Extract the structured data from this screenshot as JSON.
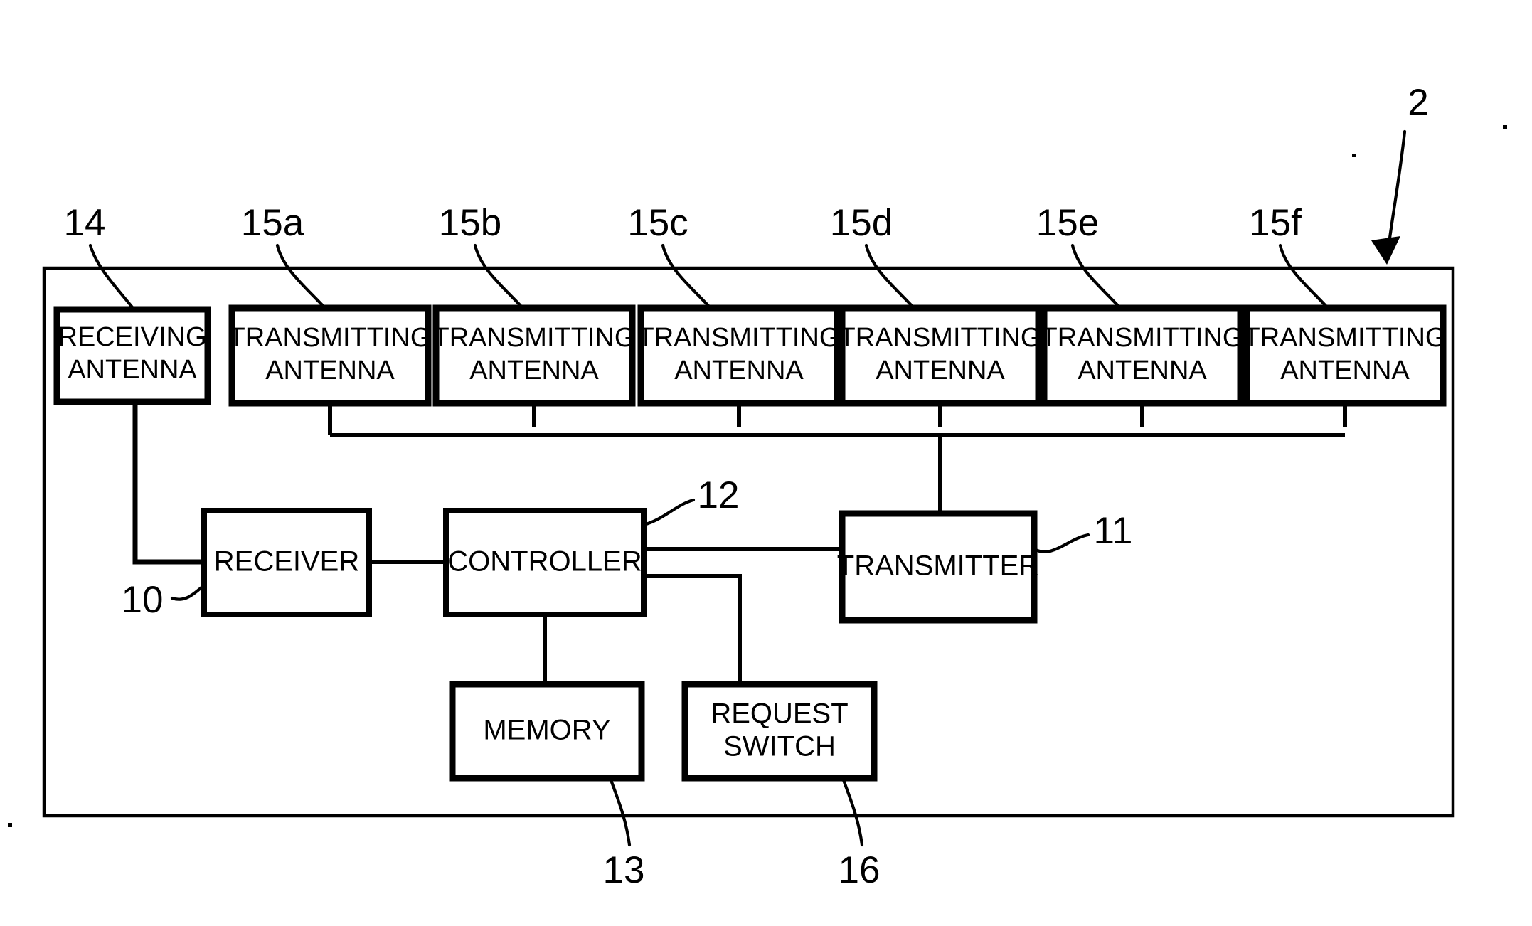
{
  "figure": {
    "title": "Block diagram of vehicle-mounted transmitter/receiver unit",
    "frame_ref": "2",
    "background_color": "#ffffff",
    "line_color": "#000000"
  },
  "antennas": {
    "receiving": {
      "ref": "14",
      "line1": "RECEIVING",
      "line2": "ANTENNA"
    },
    "transmitting": [
      {
        "ref": "15a",
        "line1": "TRANSMITTING",
        "line2": "ANTENNA"
      },
      {
        "ref": "15b",
        "line1": "TRANSMITTING",
        "line2": "ANTENNA"
      },
      {
        "ref": "15c",
        "line1": "TRANSMITTING",
        "line2": "ANTENNA"
      },
      {
        "ref": "15d",
        "line1": "TRANSMITTING",
        "line2": "ANTENNA"
      },
      {
        "ref": "15e",
        "line1": "TRANSMITTING",
        "line2": "ANTENNA"
      },
      {
        "ref": "15f",
        "line1": "TRANSMITTING",
        "line2": "ANTENNA"
      }
    ]
  },
  "blocks": {
    "receiver": {
      "ref": "10",
      "label": "RECEIVER"
    },
    "controller": {
      "ref": "12",
      "label": "CONTROLLER"
    },
    "transmitter": {
      "ref": "11",
      "label": "TRANSMITTER"
    },
    "memory": {
      "ref": "13",
      "label": "MEMORY"
    },
    "request_switch": {
      "ref": "16",
      "line1": "REQUEST",
      "line2": "SWITCH"
    }
  },
  "reference_numerals": {
    "frame": "2",
    "receiver": "10",
    "transmitter": "11",
    "controller": "12",
    "memory": "13",
    "receiving_antenna": "14",
    "transmitting_antenna_a": "15a",
    "transmitting_antenna_b": "15b",
    "transmitting_antenna_c": "15c",
    "transmitting_antenna_d": "15d",
    "transmitting_antenna_e": "15e",
    "transmitting_antenna_f": "15f",
    "request_switch": "16"
  }
}
